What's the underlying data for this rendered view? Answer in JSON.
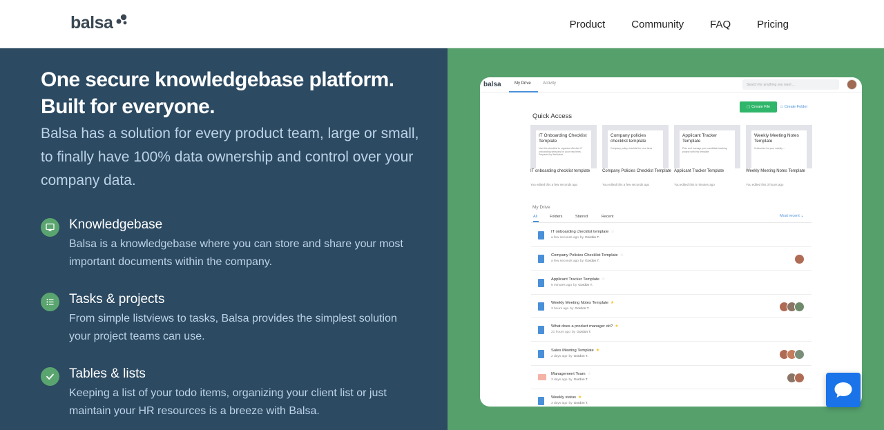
{
  "brand": {
    "logo_text": "balsa"
  },
  "nav": [
    {
      "label": "Product"
    },
    {
      "label": "Community"
    },
    {
      "label": "FAQ"
    },
    {
      "label": "Pricing"
    }
  ],
  "hero": {
    "headline_line1": "One secure knowledgebase platform.",
    "headline_line2": "Built for everyone.",
    "subhead": "Balsa has a solution for every product team, large or small, to finally have 100% data ownership and control over your company data."
  },
  "features": [
    {
      "icon": "knowledgebase-icon",
      "title": "Knowledgebase",
      "desc": "Balsa is a knowledgebase where you can store and share your most important documents within the company."
    },
    {
      "icon": "list-icon",
      "title": "Tasks & projects",
      "desc": "From simple listviews to tasks, Balsa provides the simplest solution your project teams can use."
    },
    {
      "icon": "check-icon",
      "title": "Tables & lists",
      "desc": "Keeping a list of your todo items, organizing your client list or just maintain your HR resources is a breeze with Balsa."
    }
  ],
  "app": {
    "logo": "balsa",
    "tabs": [
      "My Drive",
      "Activity"
    ],
    "search_placeholder": "Search for anything you want ...",
    "create_file": "Create File",
    "create_folder": "Create Folder",
    "quick_access_title": "Quick Access",
    "cards": [
      {
        "card_title": "IT Onboarding Checklist Template",
        "card_desc": "Use this checklist to organize effective IT onboarding sessions for your new hires. Prepared by Wellcable.",
        "name": "IT onboarding checklist template",
        "sub": "You edited this a few seconds ago"
      },
      {
        "card_title": "Company policies checklist template",
        "card_desc": "Company policy checklist for new hires",
        "name": "Company Policies Checklist Template",
        "sub": "You edited this a few seconds ago"
      },
      {
        "card_title": "Applicant Tracker Template",
        "card_desc": "Plan and manage your candidate tracking project with this template",
        "name": "Applicant Tracker Template",
        "sub": "You edited this 5 minutes ago"
      },
      {
        "card_title": "Weekly Meeting Notes Template",
        "card_desc": "Customize for your weekly ...",
        "name": "Weekly Meeting Notes Template",
        "sub": "You edited this 3 hours ago"
      }
    ],
    "my_drive_title": "My Drive",
    "drive_tabs": [
      "All",
      "Folders",
      "Starred",
      "Recent"
    ],
    "sort_label": "Most recent",
    "rows": [
      {
        "title": "IT onboarding checklist template",
        "time": "a few seconds ago",
        "by": "by",
        "author": "Gordon T.",
        "starred": false,
        "avatars": []
      },
      {
        "title": "Company Policies Checklist Template",
        "time": "a few seconds ago",
        "by": "by",
        "author": "Gordon T.",
        "starred": false,
        "avatars": [
          "#b06b55"
        ]
      },
      {
        "title": "Applicant Tracker Template",
        "time": "5 minutes ago",
        "by": "by",
        "author": "Gordon T.",
        "starred": false,
        "avatars": []
      },
      {
        "title": "Weekly Meeting Notes Template",
        "time": "3 hours ago",
        "by": "by",
        "author": "Gordon T.",
        "starred": true,
        "avatars": [
          "#b06b55",
          "#8a7566",
          "#6e8a6b"
        ]
      },
      {
        "title": "What does a product manager do?",
        "time": "21 hours ago",
        "by": "by",
        "author": "Gordon T.",
        "starred": true,
        "avatars": []
      },
      {
        "title": "Sales Meeting Template",
        "time": "2 days ago",
        "by": "by",
        "author": "Gordon T.",
        "starred": true,
        "avatars": [
          "#b06b55",
          "#c47d5e",
          "#7a8d79"
        ]
      },
      {
        "title": "Management Team",
        "time": "3 days ago",
        "by": "by",
        "author": "Gordon T.",
        "starred": false,
        "avatars": [
          "#8a7566",
          "#b06b55"
        ],
        "folder": true
      },
      {
        "title": "Weekly status",
        "time": "3 days ago",
        "by": "by",
        "author": "Gordon T.",
        "starred": true,
        "avatars": []
      }
    ]
  },
  "colors": {
    "left_bg": "#2c4a62",
    "right_bg": "#56a06c",
    "accent_green": "#5aa56f",
    "chat_blue": "#1a73e8"
  }
}
